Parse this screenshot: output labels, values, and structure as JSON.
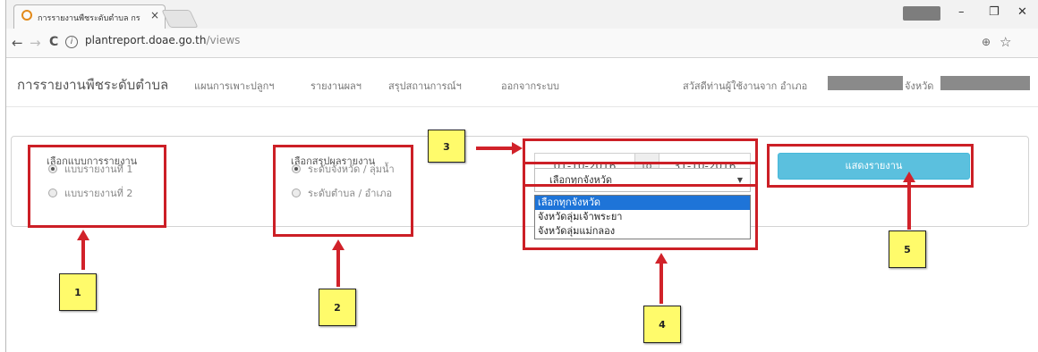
{
  "browser": {
    "tab_title": "การรายงานพืชระดับตำบล กร",
    "tab_close": "×",
    "win_minimize": "–",
    "win_maximize": "❐",
    "win_close": "✕",
    "nav_back": "←",
    "nav_forward": "→",
    "nav_reload": "C",
    "info_glyph": "i",
    "address_domain": "plantreport.doae.go.th",
    "address_path": "/views",
    "zoom_glyph": "⊕",
    "star_glyph": "☆"
  },
  "app": {
    "brand": "การรายงานพืชระดับตำบล",
    "nav": [
      "แผนการเพาะปลูกฯ",
      "รายงานผลฯ",
      "สรุปสถานการณ์ฯ",
      "ออกจากระบบ"
    ],
    "greeting_prefix": "สวัสดีท่านผู้ใช้งานจาก อำเภอ",
    "greeting_province": "จังหวัด"
  },
  "form": {
    "report_type_title": "เลือกแบบการรายงาน",
    "report_types": [
      {
        "label": "แบบรายงานที่ 1",
        "selected": true
      },
      {
        "label": "แบบรายงานที่ 2",
        "selected": false
      }
    ],
    "summary_title": "เลือกสรุปผลรายงาน",
    "summary_levels": [
      {
        "label": "ระดับจังหวัด / ลุ่มน้ำ",
        "selected": true
      },
      {
        "label": "ระดับตำบล / อำเภอ",
        "selected": false
      }
    ],
    "date_from": "01-10-2016",
    "date_sep": "to",
    "date_to": "31-10-2016",
    "province_select": {
      "value": "เลือกทุกจังหวัด",
      "caret": "▼",
      "options": [
        "เลือกทุกจังหวัด",
        "จังหวัดลุ่มเจ้าพระยา",
        "จังหวัดลุ่มแม่กลอง"
      ],
      "selected_index": 0
    },
    "show_button": "แสดงรายงาน"
  },
  "annotations": [
    "1",
    "2",
    "3",
    "4",
    "5"
  ],
  "colors": {
    "annotation_red": "#cc1f26",
    "callout_yellow": "#fffb6b",
    "button_info": "#5bc0de",
    "dropdown_highlight": "#1e74d8"
  }
}
